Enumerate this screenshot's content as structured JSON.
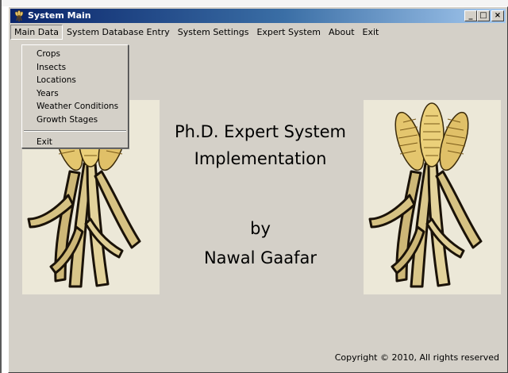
{
  "window": {
    "title": "System Main",
    "caption_buttons": {
      "minimize": "_",
      "maximize": "□",
      "close": "×"
    }
  },
  "menubar": {
    "items": [
      {
        "label": "Main Data",
        "active": true
      },
      {
        "label": "System Database Entry"
      },
      {
        "label": "System Settings"
      },
      {
        "label": "Expert System"
      },
      {
        "label": "About"
      },
      {
        "label": "Exit"
      }
    ]
  },
  "dropdown": {
    "items": [
      {
        "label": "Crops"
      },
      {
        "label": "Insects"
      },
      {
        "label": "Locations"
      },
      {
        "label": "Years"
      },
      {
        "label": "Weather Conditions"
      },
      {
        "label": "Growth Stages"
      }
    ],
    "exit_label": "Exit"
  },
  "main": {
    "title_line1": "Ph.D. Expert System",
    "title_line2": "Implementation",
    "by": "by",
    "author": "Nawal Gaafar",
    "copyright": "Copyright © 2010, All rights reserved"
  },
  "icons": {
    "app": "wheat-icon",
    "decoration": "wheat-bundle-icon"
  },
  "colors": {
    "titlebar_start": "#0a246a",
    "titlebar_end": "#a6caf0",
    "window_face": "#d4d0c8",
    "panel_bg": "#ece8d8",
    "wheat_gold": "#d9b96a"
  }
}
